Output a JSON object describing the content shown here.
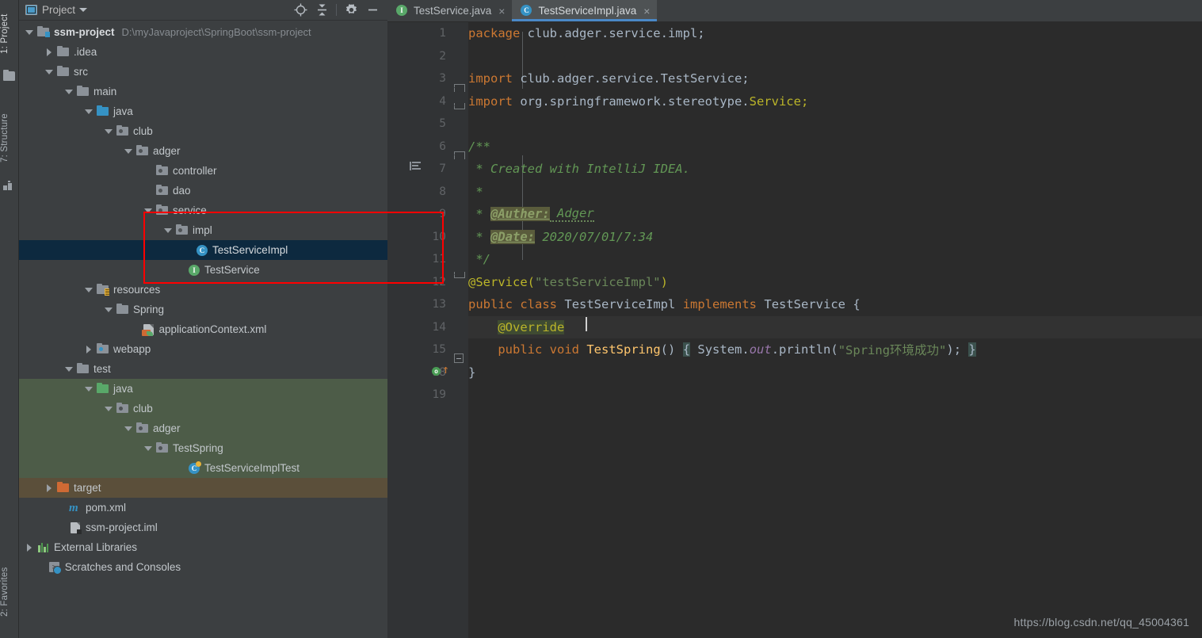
{
  "tool_strip": {
    "tabs": [
      {
        "label": "1: Project",
        "icon": "folder-icon",
        "active": true
      },
      {
        "label": "7: Structure",
        "icon": "structure-icon",
        "active": false
      },
      {
        "label": "2: Favorites",
        "icon": "favorites-icon",
        "active": false
      }
    ]
  },
  "project_panel": {
    "title": "Project",
    "icons": {
      "project_icon": "project-view-icon",
      "dropdown": "chevron-down-icon",
      "locate": "locate-target-icon",
      "collapse_all": "collapse-all-icon",
      "settings": "gear-icon",
      "hide": "minimize-icon"
    },
    "tree": [
      {
        "label": "ssm-project",
        "path": "D:\\myJavaproject\\SpringBoot\\ssm-project",
        "depth": 0,
        "arrow": "open",
        "icon": "module-folder",
        "bold": true
      },
      {
        "label": ".idea",
        "path": "",
        "depth": 1,
        "arrow": "closed",
        "icon": "folder-grey"
      },
      {
        "label": "src",
        "path": "",
        "depth": 1,
        "arrow": "open",
        "icon": "folder-grey"
      },
      {
        "label": "main",
        "path": "",
        "depth": 2,
        "arrow": "open",
        "icon": "folder-grey"
      },
      {
        "label": "java",
        "path": "",
        "depth": 3,
        "arrow": "open",
        "icon": "folder-source-blue"
      },
      {
        "label": "club",
        "path": "",
        "depth": 4,
        "arrow": "open",
        "icon": "package"
      },
      {
        "label": "adger",
        "path": "",
        "depth": 5,
        "arrow": "open",
        "icon": "package"
      },
      {
        "label": "controller",
        "path": "",
        "depth": 6,
        "arrow": "none",
        "icon": "package"
      },
      {
        "label": "dao",
        "path": "",
        "depth": 6,
        "arrow": "none",
        "icon": "package"
      },
      {
        "label": "service",
        "path": "",
        "depth": 6,
        "arrow": "open",
        "icon": "package"
      },
      {
        "label": "impl",
        "path": "",
        "depth": 7,
        "arrow": "open",
        "icon": "package"
      },
      {
        "label": "TestServiceImpl",
        "path": "",
        "depth": 8,
        "arrow": "none",
        "icon": "class",
        "selected": true
      },
      {
        "label": "TestService",
        "path": "",
        "depth": 7.6,
        "arrow": "none",
        "icon": "interface"
      },
      {
        "label": "resources",
        "path": "",
        "depth": 3,
        "arrow": "open",
        "icon": "folder-resource"
      },
      {
        "label": "Spring",
        "path": "",
        "depth": 4,
        "arrow": "open",
        "icon": "folder-grey"
      },
      {
        "label": "applicationContext.xml",
        "path": "",
        "depth": 5.3,
        "arrow": "none",
        "icon": "spring-xml"
      },
      {
        "label": "webapp",
        "path": "",
        "depth": 3,
        "arrow": "closed",
        "icon": "package-web"
      },
      {
        "label": "test",
        "path": "",
        "depth": 2,
        "arrow": "open",
        "icon": "folder-grey"
      },
      {
        "label": "java",
        "path": "",
        "depth": 3,
        "arrow": "open",
        "icon": "folder-test-green",
        "row_hl": "test"
      },
      {
        "label": "club",
        "path": "",
        "depth": 4,
        "arrow": "open",
        "icon": "package",
        "row_hl": "test"
      },
      {
        "label": "adger",
        "path": "",
        "depth": 5,
        "arrow": "open",
        "icon": "package",
        "row_hl": "test"
      },
      {
        "label": "TestSpring",
        "path": "",
        "depth": 6,
        "arrow": "open",
        "icon": "package",
        "row_hl": "test"
      },
      {
        "label": "TestServiceImplTest",
        "path": "",
        "depth": 7.6,
        "arrow": "none",
        "icon": "test-class",
        "row_hl": "test"
      },
      {
        "label": "target",
        "path": "",
        "depth": 1,
        "arrow": "closed",
        "icon": "folder-excluded-orange",
        "row_hl": "target"
      },
      {
        "label": "pom.xml",
        "path": "",
        "depth": 1.6,
        "arrow": "none",
        "icon": "maven"
      },
      {
        "label": "ssm-project.iml",
        "path": "",
        "depth": 1.6,
        "arrow": "none",
        "icon": "iml"
      },
      {
        "label": "External Libraries",
        "path": "",
        "depth": 0,
        "arrow": "closed",
        "icon": "libraries"
      },
      {
        "label": "Scratches and Consoles",
        "path": "",
        "depth": 0.55,
        "arrow": "none",
        "icon": "scratches"
      }
    ]
  },
  "editor": {
    "tabs": [
      {
        "label": "TestService.java",
        "icon": "interface",
        "active": false,
        "close": "×"
      },
      {
        "label": "TestServiceImpl.java",
        "icon": "class",
        "active": true,
        "close": "×"
      }
    ],
    "line_numbers": [
      "1",
      "2",
      "3",
      "4",
      "5",
      "6",
      "7",
      "8",
      "9",
      "10",
      "11",
      "12",
      "13",
      "14",
      "15",
      "18",
      "19"
    ],
    "code": [
      "package club.adger.service.impl;",
      "",
      "import club.adger.service.TestService;",
      "import org.springframework.stereotype.Service;",
      "",
      "/**",
      " * Created with IntelliJ IDEA.",
      " *",
      " * @Auther: Adger",
      " * @Date: 2020/07/01/7:34",
      " */",
      "@Service(\"testServiceImpl\")",
      "public class TestServiceImpl implements TestService {",
      "    @Override",
      "    public void TestSpring() { System.out.println(\"Spring环境成功\"); }",
      "}",
      ""
    ],
    "tokens": {
      "kw_package": "package",
      "pkg_name": "club.adger.service.impl;",
      "kw_import": "import",
      "import1": "club.adger.service.",
      "import1_cls": "TestService;",
      "import2": "org.springframework.stereotype.",
      "import2_cls": "Service;",
      "doc_open": "/**",
      "doc_line1": " * Created with IntelliJ IDEA.",
      "doc_line2": " *",
      "doc_star3": " * ",
      "tag_auther": "@Auther:",
      "auther_val": " Adger",
      "doc_star4": " * ",
      "tag_date": "@Date:",
      "date_val": " 2020/07/01/7:34",
      "doc_close": " */",
      "ann_service": "@Service",
      "ann_paren_open": "(",
      "ann_str": "\"testServiceImpl\"",
      "ann_paren_close": ")",
      "kw_public": "public",
      "kw_class": "class",
      "cls_name": "TestServiceImpl",
      "kw_implements": "implements",
      "iface_name": "TestService",
      "brace_open": "{",
      "ann_override": "@Override",
      "kw_public2": "public",
      "kw_void": "void",
      "method_name": "TestSpring",
      "method_parens": "()",
      "body_brace_open": "{",
      "system": "System.",
      "out": "out",
      "println": ".println(",
      "msg": "\"Spring环境成功\"",
      "semi_close": ");",
      "body_brace_close": "}",
      "class_brace_close": "}"
    },
    "gutter_marks": {
      "line6_structure": "doc-structure-icon",
      "line15_override": "overridden-method-icon",
      "line15_arrow": "↑"
    }
  },
  "watermark": "https://blog.csdn.net/qq_45004361",
  "colors": {
    "accent_blue": "#4a88c7",
    "selection_navy": "#0d293f",
    "test_root_green": "#4d5c48",
    "excluded_brown": "#5b4f3a",
    "annotation_red": "#ff0000",
    "editor_bg": "#2b2b2b",
    "panel_bg": "#3c3f41"
  }
}
